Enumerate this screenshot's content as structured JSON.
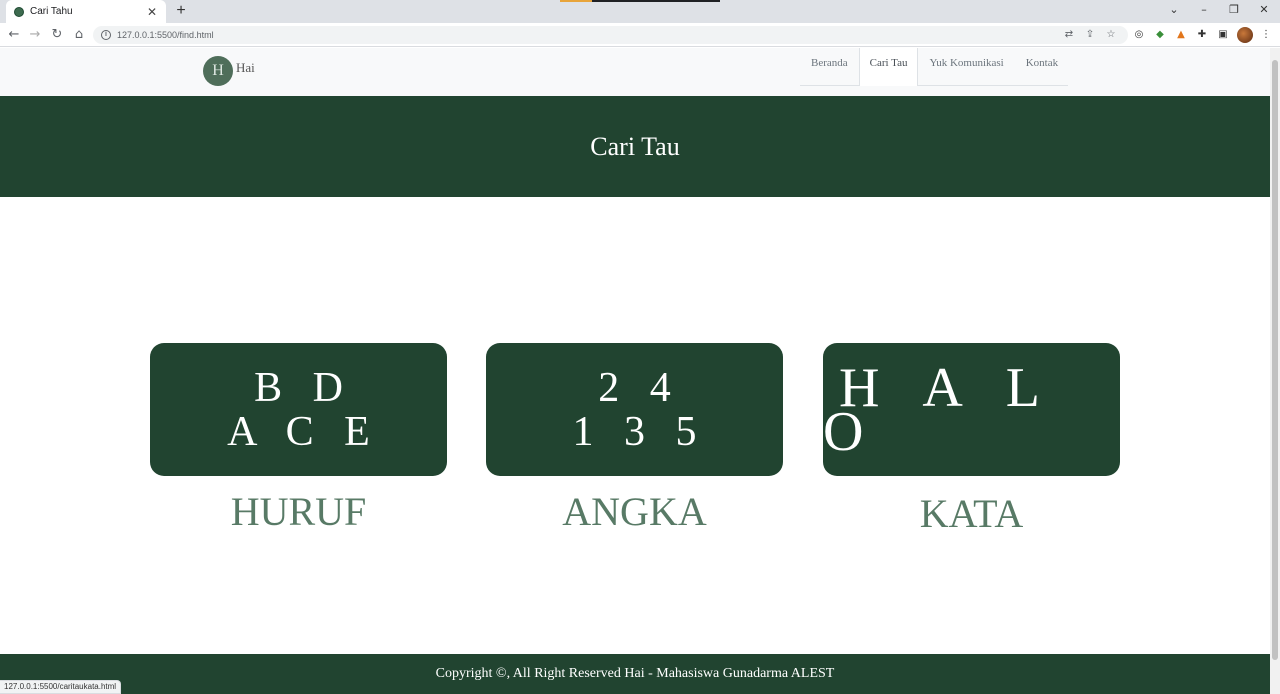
{
  "browser": {
    "tab_title": "Cari Tahu",
    "url": "127.0.0.1:5500/find.html",
    "status_url": "127.0.0.1:5500/caritaukata.html"
  },
  "site": {
    "brand": "Hai",
    "logo_letter": "H",
    "menu": [
      "Beranda",
      "Cari Tau",
      "Yuk Komunikasi",
      "Kontak"
    ],
    "active_menu": "Cari Tau"
  },
  "hero": {
    "title": "Cari Tau"
  },
  "cards": [
    {
      "lines": [
        "B D",
        "A C E"
      ],
      "label": "HURUF"
    },
    {
      "lines": [
        "2 4",
        "1 3 5"
      ],
      "label": "ANGKA"
    },
    {
      "lines": [
        "H A L O"
      ],
      "label": "KATA"
    }
  ],
  "footer": {
    "text": "Copyright ©, All Right Reserved Hai - Mahasiswa Gunadarma ALEST"
  },
  "colors": {
    "primary": "#214430",
    "label": "#587a66"
  }
}
